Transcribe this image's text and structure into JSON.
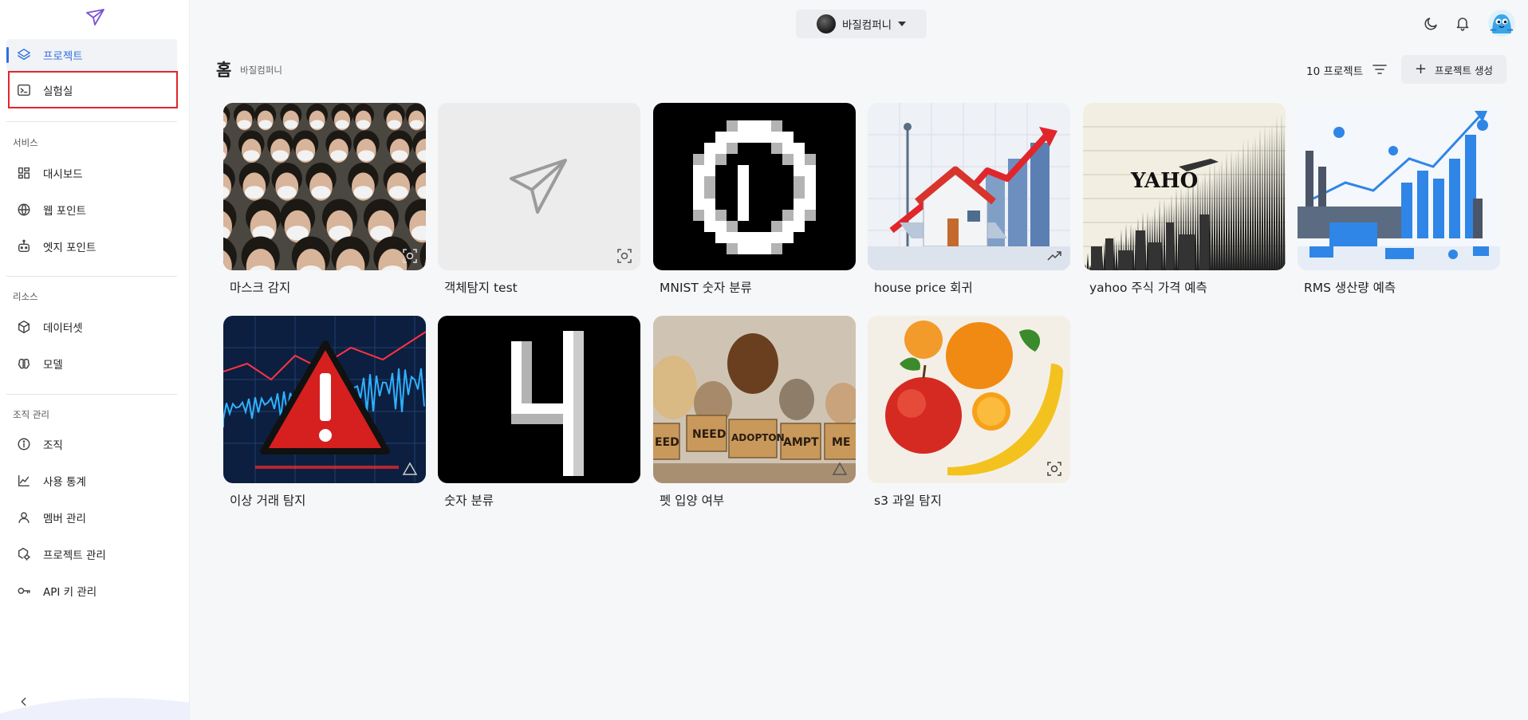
{
  "sidebar": {
    "nav_top": [
      {
        "label": "프로젝트",
        "icon": "layers-icon",
        "active": true
      },
      {
        "label": "실험실",
        "icon": "terminal-icon",
        "active": false
      }
    ],
    "sections": [
      {
        "title": "서비스",
        "items": [
          {
            "label": "대시보드",
            "icon": "dashboard-icon"
          },
          {
            "label": "웹 포인트",
            "icon": "globe-icon"
          },
          {
            "label": "엣지 포인트",
            "icon": "robot-icon"
          }
        ]
      },
      {
        "title": "리소스",
        "items": [
          {
            "label": "데이터셋",
            "icon": "cube-icon"
          },
          {
            "label": "모델",
            "icon": "brain-icon"
          }
        ]
      },
      {
        "title": "조직 관리",
        "items": [
          {
            "label": "조직",
            "icon": "info-icon"
          },
          {
            "label": "사용 통계",
            "icon": "line-chart-icon"
          },
          {
            "label": "멤버 관리",
            "icon": "user-icon"
          },
          {
            "label": "프로젝트 관리",
            "icon": "project-settings-icon"
          },
          {
            "label": "API 키 관리",
            "icon": "key-icon"
          }
        ]
      }
    ]
  },
  "header": {
    "org_name": "바질컴퍼니"
  },
  "main": {
    "title": "홈",
    "subtitle": "바질컴퍼니",
    "project_count": "10 프로젝트",
    "create_label": "프로젝트 생성",
    "projects": [
      {
        "title": "마스크 감지",
        "badge": "object-detect-icon"
      },
      {
        "title": "객체탐지 test",
        "badge": "object-detect-icon"
      },
      {
        "title": "MNIST 숫자 분류",
        "badge": ""
      },
      {
        "title": "house price 회귀",
        "badge": "trend-icon"
      },
      {
        "title": "yahoo 주식 가격 예측",
        "badge": ""
      },
      {
        "title": "RMS 생산량 예측",
        "badge": ""
      },
      {
        "title": "이상 거래 탐지",
        "badge": "anomaly-icon"
      },
      {
        "title": "숫자 분류",
        "badge": ""
      },
      {
        "title": "펫 입양 여부",
        "badge": "anomaly-icon"
      },
      {
        "title": "s3 과일 탐지",
        "badge": "object-detect-icon"
      }
    ]
  },
  "image_text": {
    "yahoo_logo": "YAHO",
    "pet_signs": [
      "EED",
      "NEED",
      "ADOPTON",
      "AMPT",
      "ME"
    ]
  },
  "colors": {
    "accent": "#2f6fe0",
    "highlight": "#e0262b"
  }
}
